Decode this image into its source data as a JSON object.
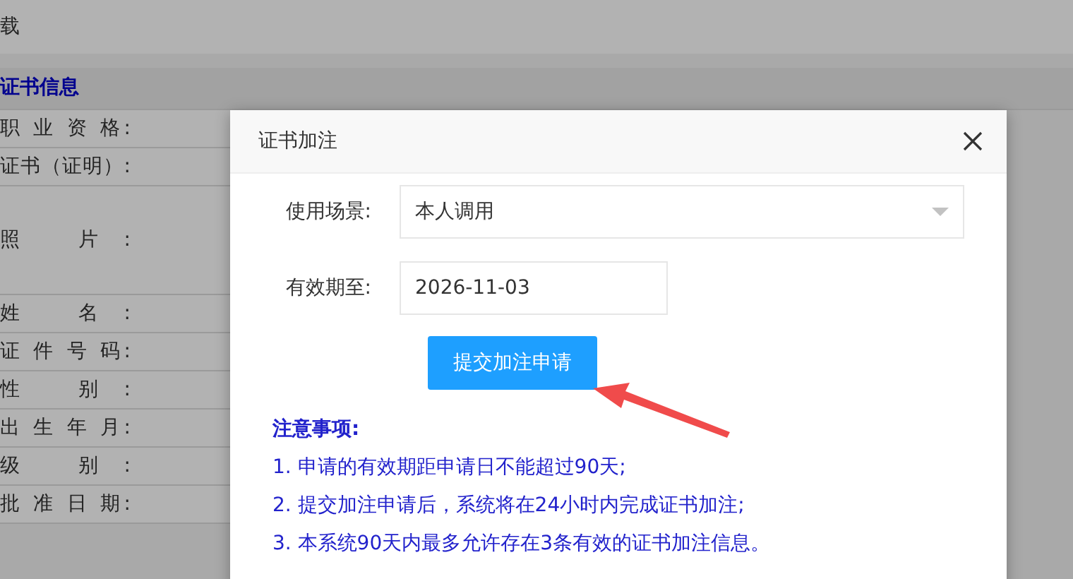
{
  "top_bar": {
    "link": "载"
  },
  "background_panel": {
    "section_title": "证书信息",
    "fields": [
      {
        "label": "职 业 资 格:",
        "kind": "row"
      },
      {
        "label": "证书（证明）:",
        "kind": "row"
      },
      {
        "label": "照 片:",
        "kind": "photo"
      },
      {
        "label": "姓 名:",
        "kind": "row"
      },
      {
        "label": "证 件 号 码:",
        "kind": "row"
      },
      {
        "label": "性 别:",
        "kind": "row"
      },
      {
        "label": "出 生 年 月:",
        "kind": "row"
      },
      {
        "label": "级 别:",
        "kind": "row"
      },
      {
        "label": "批 准 日 期:",
        "kind": "row"
      }
    ]
  },
  "dialog": {
    "title": "证书加注",
    "usage_scene": {
      "label": "使用场景:",
      "value": "本人调用"
    },
    "valid_until": {
      "label": "有效期至:",
      "value": "2026-11-03"
    },
    "submit_button": "提交加注申请",
    "notes": {
      "title": "注意事项:",
      "items": [
        "1. 申请的有效期距申请日不能超过90天;",
        "2. 提交加注申请后，系统将在24小时内完成证书加注;",
        "3. 本系统90天内最多允许存在3条有效的证书加注信息。"
      ]
    }
  }
}
